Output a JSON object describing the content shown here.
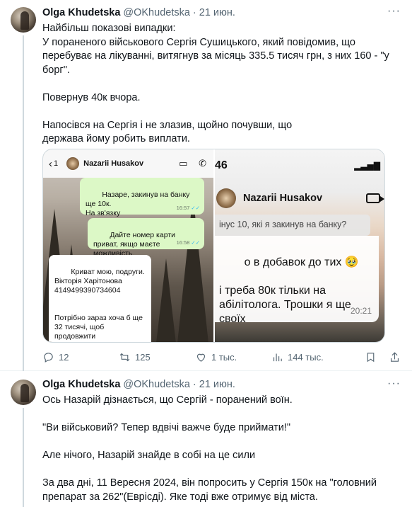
{
  "tweet1": {
    "name": "Olga Khudetska",
    "handle": "@OKhudetska",
    "dot": "·",
    "time": "21 июн.",
    "more": "···",
    "text": "Найбільш показові випадки:\nУ пораненого військового Сергія Сушицького, який повідомив, що перебуває на лікуванні, витягнув за місяць 335.5 тисяч грн, з них 160 - \"у борг\".\n\nПовернув 40к вчора.\n\nНапосівся на Сергія і не злазив, щойно почувши, що\nдержава йому робить виплати.",
    "media": {
      "shot1": {
        "back_glyph": "‹",
        "back_count": "1",
        "contact": "Nazarii Husakov",
        "bubble1": "Назаре, закинув на банку ще 10к.\nНа зв'язку",
        "bubble1_time": "16:57",
        "bubble2": "Дайте номер карти приват, якщо маєте можливість.",
        "bubble2_time": "16:58",
        "ticks": "✓✓",
        "bubble3": "Криват мою, подруги.\nВікторія Харітонова\n4149499390734604\n\n\nПотрібно зараз хоча б ще 32 тисячі, щоб продовжити реабілітолога. Дякую вам,"
      },
      "shot2": {
        "status_time": "46",
        "signal": "▂▃▅▇",
        "contact": "Nazarii Husakov",
        "quote": "інус 10, які я закинув на банку?",
        "message": "о в добавок до тих 🥹\n\nі треба 80к тільки на\nабілітолога. Трошки я ще\nсвоїх",
        "message_time": "20:21"
      }
    },
    "actions": {
      "replies": "12",
      "retweets": "125",
      "likes": "1 тыс.",
      "views": "144 тыс."
    }
  },
  "tweet2": {
    "name": "Olga Khudetska",
    "handle": "@OKhudetska",
    "dot": "·",
    "time": "21 июн.",
    "more": "···",
    "text": "Ось Назарій дізнається, що Сергій - поранений воїн.\n\n\"Ви військовий? Тепер вдвічі важче буде приймати!\"\n\nАле нічого, Назарій знайде в собі на це сили\n\nЗа два дні, 11 Вересня 2024, він попросить у Сергія 150к на \"головний препарат за 262\"(Еврісді). Яке тоді вже отримує від міста."
  },
  "icons": {
    "reply": "reply-icon",
    "retweet": "retweet-icon",
    "like": "heart-icon",
    "views": "views-icon",
    "bookmark": "bookmark-icon",
    "share": "share-icon"
  }
}
